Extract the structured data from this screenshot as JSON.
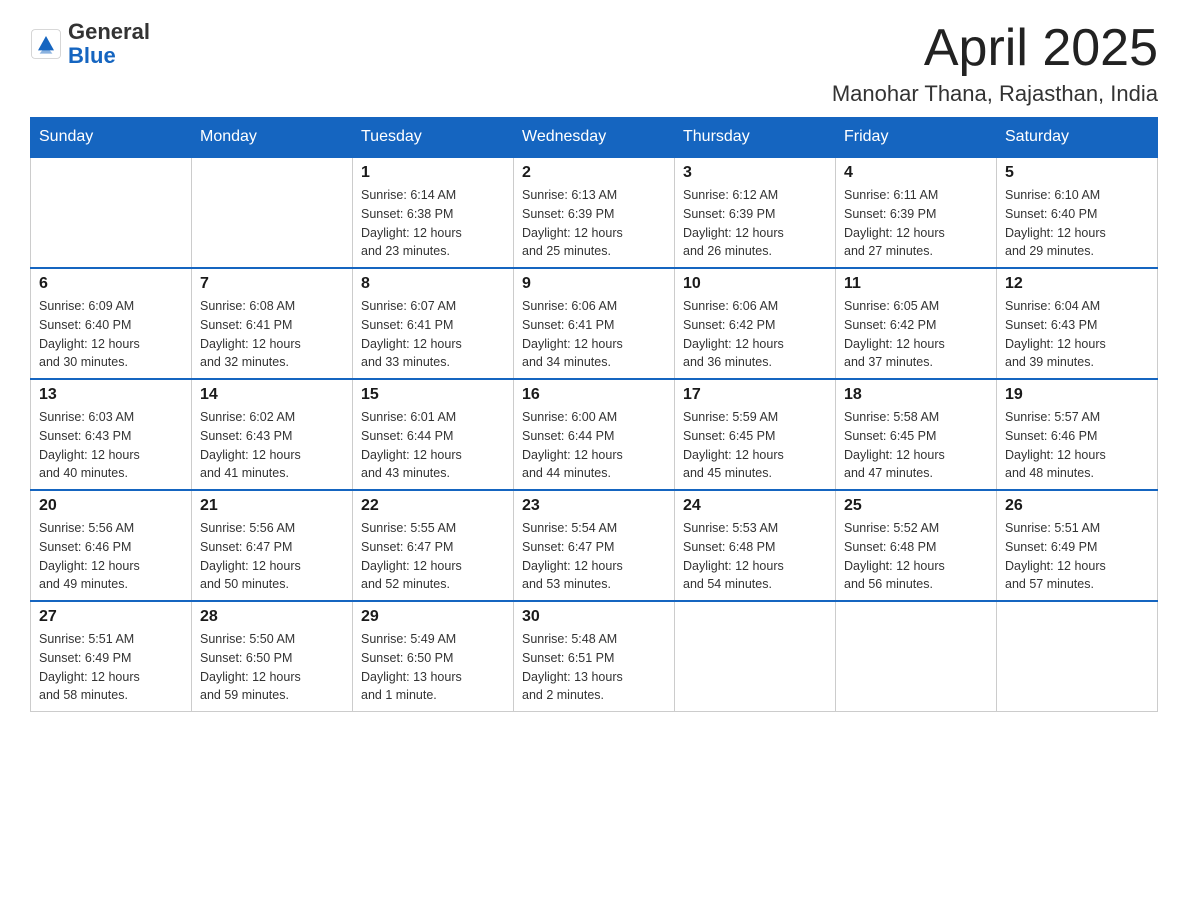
{
  "header": {
    "logo_general": "General",
    "logo_blue": "Blue",
    "title": "April 2025",
    "subtitle": "Manohar Thana, Rajasthan, India"
  },
  "days_of_week": [
    "Sunday",
    "Monday",
    "Tuesday",
    "Wednesday",
    "Thursday",
    "Friday",
    "Saturday"
  ],
  "weeks": [
    [
      {
        "day": "",
        "info": ""
      },
      {
        "day": "",
        "info": ""
      },
      {
        "day": "1",
        "info": "Sunrise: 6:14 AM\nSunset: 6:38 PM\nDaylight: 12 hours\nand 23 minutes."
      },
      {
        "day": "2",
        "info": "Sunrise: 6:13 AM\nSunset: 6:39 PM\nDaylight: 12 hours\nand 25 minutes."
      },
      {
        "day": "3",
        "info": "Sunrise: 6:12 AM\nSunset: 6:39 PM\nDaylight: 12 hours\nand 26 minutes."
      },
      {
        "day": "4",
        "info": "Sunrise: 6:11 AM\nSunset: 6:39 PM\nDaylight: 12 hours\nand 27 minutes."
      },
      {
        "day": "5",
        "info": "Sunrise: 6:10 AM\nSunset: 6:40 PM\nDaylight: 12 hours\nand 29 minutes."
      }
    ],
    [
      {
        "day": "6",
        "info": "Sunrise: 6:09 AM\nSunset: 6:40 PM\nDaylight: 12 hours\nand 30 minutes."
      },
      {
        "day": "7",
        "info": "Sunrise: 6:08 AM\nSunset: 6:41 PM\nDaylight: 12 hours\nand 32 minutes."
      },
      {
        "day": "8",
        "info": "Sunrise: 6:07 AM\nSunset: 6:41 PM\nDaylight: 12 hours\nand 33 minutes."
      },
      {
        "day": "9",
        "info": "Sunrise: 6:06 AM\nSunset: 6:41 PM\nDaylight: 12 hours\nand 34 minutes."
      },
      {
        "day": "10",
        "info": "Sunrise: 6:06 AM\nSunset: 6:42 PM\nDaylight: 12 hours\nand 36 minutes."
      },
      {
        "day": "11",
        "info": "Sunrise: 6:05 AM\nSunset: 6:42 PM\nDaylight: 12 hours\nand 37 minutes."
      },
      {
        "day": "12",
        "info": "Sunrise: 6:04 AM\nSunset: 6:43 PM\nDaylight: 12 hours\nand 39 minutes."
      }
    ],
    [
      {
        "day": "13",
        "info": "Sunrise: 6:03 AM\nSunset: 6:43 PM\nDaylight: 12 hours\nand 40 minutes."
      },
      {
        "day": "14",
        "info": "Sunrise: 6:02 AM\nSunset: 6:43 PM\nDaylight: 12 hours\nand 41 minutes."
      },
      {
        "day": "15",
        "info": "Sunrise: 6:01 AM\nSunset: 6:44 PM\nDaylight: 12 hours\nand 43 minutes."
      },
      {
        "day": "16",
        "info": "Sunrise: 6:00 AM\nSunset: 6:44 PM\nDaylight: 12 hours\nand 44 minutes."
      },
      {
        "day": "17",
        "info": "Sunrise: 5:59 AM\nSunset: 6:45 PM\nDaylight: 12 hours\nand 45 minutes."
      },
      {
        "day": "18",
        "info": "Sunrise: 5:58 AM\nSunset: 6:45 PM\nDaylight: 12 hours\nand 47 minutes."
      },
      {
        "day": "19",
        "info": "Sunrise: 5:57 AM\nSunset: 6:46 PM\nDaylight: 12 hours\nand 48 minutes."
      }
    ],
    [
      {
        "day": "20",
        "info": "Sunrise: 5:56 AM\nSunset: 6:46 PM\nDaylight: 12 hours\nand 49 minutes."
      },
      {
        "day": "21",
        "info": "Sunrise: 5:56 AM\nSunset: 6:47 PM\nDaylight: 12 hours\nand 50 minutes."
      },
      {
        "day": "22",
        "info": "Sunrise: 5:55 AM\nSunset: 6:47 PM\nDaylight: 12 hours\nand 52 minutes."
      },
      {
        "day": "23",
        "info": "Sunrise: 5:54 AM\nSunset: 6:47 PM\nDaylight: 12 hours\nand 53 minutes."
      },
      {
        "day": "24",
        "info": "Sunrise: 5:53 AM\nSunset: 6:48 PM\nDaylight: 12 hours\nand 54 minutes."
      },
      {
        "day": "25",
        "info": "Sunrise: 5:52 AM\nSunset: 6:48 PM\nDaylight: 12 hours\nand 56 minutes."
      },
      {
        "day": "26",
        "info": "Sunrise: 5:51 AM\nSunset: 6:49 PM\nDaylight: 12 hours\nand 57 minutes."
      }
    ],
    [
      {
        "day": "27",
        "info": "Sunrise: 5:51 AM\nSunset: 6:49 PM\nDaylight: 12 hours\nand 58 minutes."
      },
      {
        "day": "28",
        "info": "Sunrise: 5:50 AM\nSunset: 6:50 PM\nDaylight: 12 hours\nand 59 minutes."
      },
      {
        "day": "29",
        "info": "Sunrise: 5:49 AM\nSunset: 6:50 PM\nDaylight: 13 hours\nand 1 minute."
      },
      {
        "day": "30",
        "info": "Sunrise: 5:48 AM\nSunset: 6:51 PM\nDaylight: 13 hours\nand 2 minutes."
      },
      {
        "day": "",
        "info": ""
      },
      {
        "day": "",
        "info": ""
      },
      {
        "day": "",
        "info": ""
      }
    ]
  ]
}
